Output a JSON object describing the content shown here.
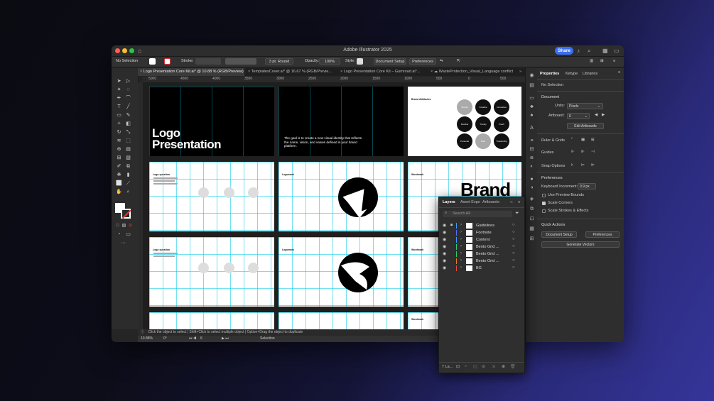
{
  "app": {
    "title": "Adobe Illustrator 2025",
    "share_label": "Share"
  },
  "control_bar": {
    "selection": "No Selection",
    "stroke_label": "Stroke:",
    "stroke_style": "3 pt. Round",
    "opacity_label": "Opacity:",
    "opacity_value": "100%",
    "style_label": "Style:",
    "document_setup": "Document Setup",
    "preferences": "Preferences"
  },
  "tabs": [
    {
      "label": "Logo Presentation Core Kit.ai* @ 10.88 % (RGB/Preview)"
    },
    {
      "label": "TemplatesCover.ai* @ 16.67 % (RGB/Previe..."
    },
    {
      "label": "Logo Presentation Core Kit – Gumroad.ai*..."
    },
    {
      "label": "WasteProtection_Visual_Language conflict"
    }
  ],
  "ruler": {
    "ticks": [
      "5000",
      "4500",
      "4000",
      "3500",
      "3000",
      "2500",
      "2000",
      "1500",
      "1000",
      "500",
      "0",
      "500"
    ]
  },
  "artboards": {
    "cover_title": "Logo Presentation",
    "cover_text": "The goal is to create a new visual identity that reflects the name, vision, and values defined in your brand platform.",
    "brand_attr": "Brand Attributes",
    "attributes": [
      "Simple",
      "Creative",
      "Innovative",
      "Flexible",
      "Trendy",
      "Fresh",
      "Personal",
      "Bold",
      "Trustworthy"
    ],
    "logo_question": "Logo question",
    "logomark": "Logomark",
    "wordmark": "Wordmark",
    "brand_big": "Brand"
  },
  "status": {
    "hint": "Click the object to select | Shift+Click to select multiple object | Option+Drag the object to duplicate",
    "zoom": "10.88%",
    "angle": "0°",
    "artboard": "6",
    "mode": "Selection"
  },
  "properties": {
    "tabs": [
      "Properties",
      "Ketype",
      "Libraries"
    ],
    "no_selection": "No Selection",
    "document": "Document",
    "units_label": "Units:",
    "units_value": "Pixels",
    "artboard_label": "Artboard:",
    "artboard_value": "6",
    "edit_artboards": "Edit Artboards",
    "ruler_grids": "Ruler & Grids",
    "guides": "Guides",
    "snap_options": "Snap Options",
    "preferences": "Preferences",
    "keyboard_inc_label": "Keyboard Increment:",
    "keyboard_inc_value": "0.9 px",
    "use_preview": "Use Preview Bounds",
    "scale_corners": "Scale Corners",
    "scale_strokes": "Scale Strokes & Effects",
    "quick_actions": "Quick Actions",
    "document_setup": "Document Setup",
    "preferences_btn": "Preferences",
    "generate_vectors": "Generate Vectors"
  },
  "layers_panel": {
    "tabs": [
      "Layers",
      "Asset Expo",
      "Artboards"
    ],
    "search_placeholder": "Search All",
    "layers": [
      {
        "name": "Guidelines",
        "color": "#3aa0ff"
      },
      {
        "name": "Footnote",
        "color": "#5a6bff"
      },
      {
        "name": "Content",
        "color": "#3aa0ff"
      },
      {
        "name": "Bento Grid ...",
        "color": "#2ecc71"
      },
      {
        "name": "Bento Grid ...",
        "color": "#2ecc71"
      },
      {
        "name": "Bento Grid ...",
        "color": "#e67e22"
      },
      {
        "name": "BG",
        "color": "#e74c3c"
      }
    ],
    "count": "7 La..."
  }
}
